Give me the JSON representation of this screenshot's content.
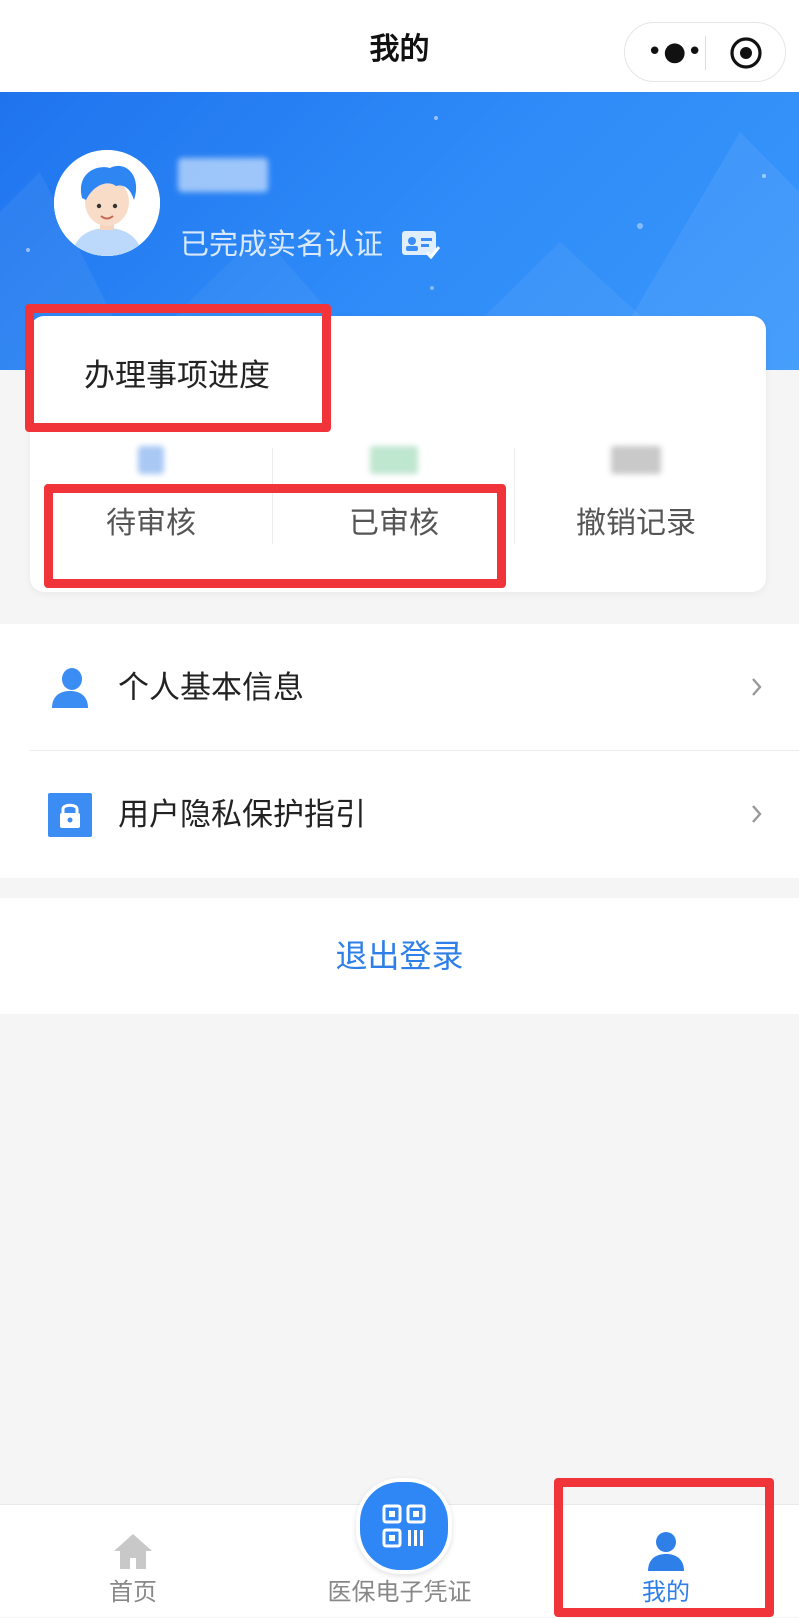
{
  "navbar": {
    "title": "我的"
  },
  "profile": {
    "auth_status": "已完成实名认证"
  },
  "progress": {
    "title": "办理事项进度",
    "stats": [
      {
        "label": "待审核"
      },
      {
        "label": "已审核"
      },
      {
        "label": "撤销记录"
      }
    ]
  },
  "menu": [
    {
      "label": "个人基本信息",
      "icon": "user-icon"
    },
    {
      "label": "用户隐私保护指引",
      "icon": "lock-icon"
    }
  ],
  "logout_label": "退出登录",
  "tabbar": [
    {
      "label": "首页",
      "icon": "home-icon",
      "active": false
    },
    {
      "label": "医保电子凭证",
      "icon": "qr-code-icon",
      "active": false
    },
    {
      "label": "我的",
      "icon": "user-icon",
      "active": true
    }
  ],
  "colors": {
    "brand_blue": "#2f7fe8",
    "hero_gradient_start": "#1f74ee",
    "hero_gradient_end": "#3a97fb",
    "highlight_red": "#f0343a",
    "page_background": "#f5f5f5"
  }
}
